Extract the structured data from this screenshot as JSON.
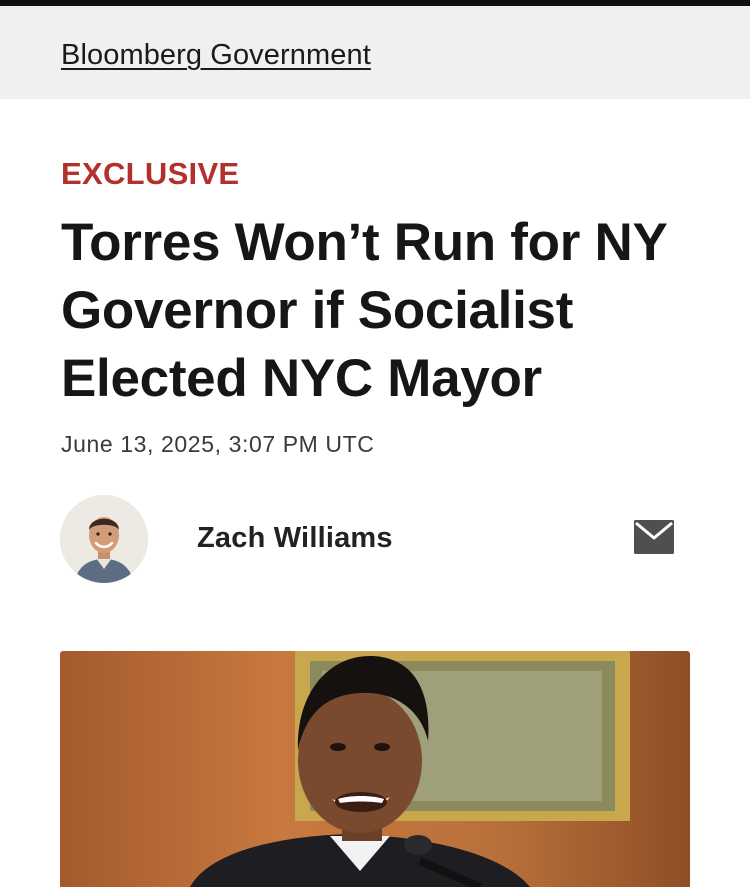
{
  "header": {
    "brand": "Bloomberg Government"
  },
  "article": {
    "kicker": "EXCLUSIVE",
    "headline": "Torres Won’t Run for NY Governor if Socialist Elected NYC Mayor",
    "timestamp": "June 13, 2025, 3:07 PM UTC"
  },
  "byline": {
    "author": "Zach Williams",
    "contact_icon": "mail-icon"
  },
  "colors": {
    "kicker": "#b3312c",
    "header_band": "#f0f0f0",
    "text": "#161616"
  }
}
